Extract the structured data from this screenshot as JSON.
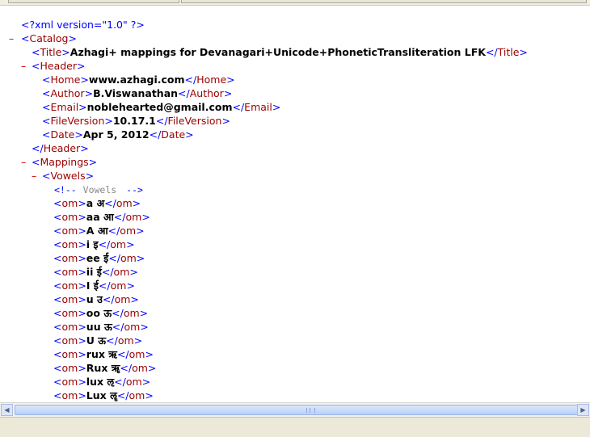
{
  "xml": {
    "declaration": "<?xml version=\"1.0\" ?>",
    "catalog_tag": "Catalog",
    "title": {
      "tag": "Title",
      "value": "Azhagi+ mappings for Devanagari+Unicode+PhoneticTransliteration LFK"
    },
    "header_tag": "Header",
    "home": {
      "tag": "Home",
      "value": "www.azhagi.com"
    },
    "author": {
      "tag": "Author",
      "value": "B.Viswanathan"
    },
    "email": {
      "tag": "Email",
      "value": "noblehearted@gmail.com"
    },
    "fileversion": {
      "tag": "FileVersion",
      "value": "10.17.1"
    },
    "date": {
      "tag": "Date",
      "value": "Apr 5, 2012"
    },
    "mappings_tag": "Mappings",
    "vowels_tag": "Vowels",
    "comment_open": "<!--",
    "comment_text": "Vowels",
    "comment_close": "-->",
    "om_tag": "om",
    "om_items": [
      "a अ",
      "aa आ",
      "A आ",
      "i इ",
      "ee ई",
      "ii ई",
      "I ई",
      "u उ",
      "oo ऊ",
      "uu ऊ",
      "U ऊ",
      "rux ऋ",
      "Rux ॠ",
      "lux ऌ",
      "Lux ॡ"
    ],
    "collapse_symbol": "–"
  }
}
